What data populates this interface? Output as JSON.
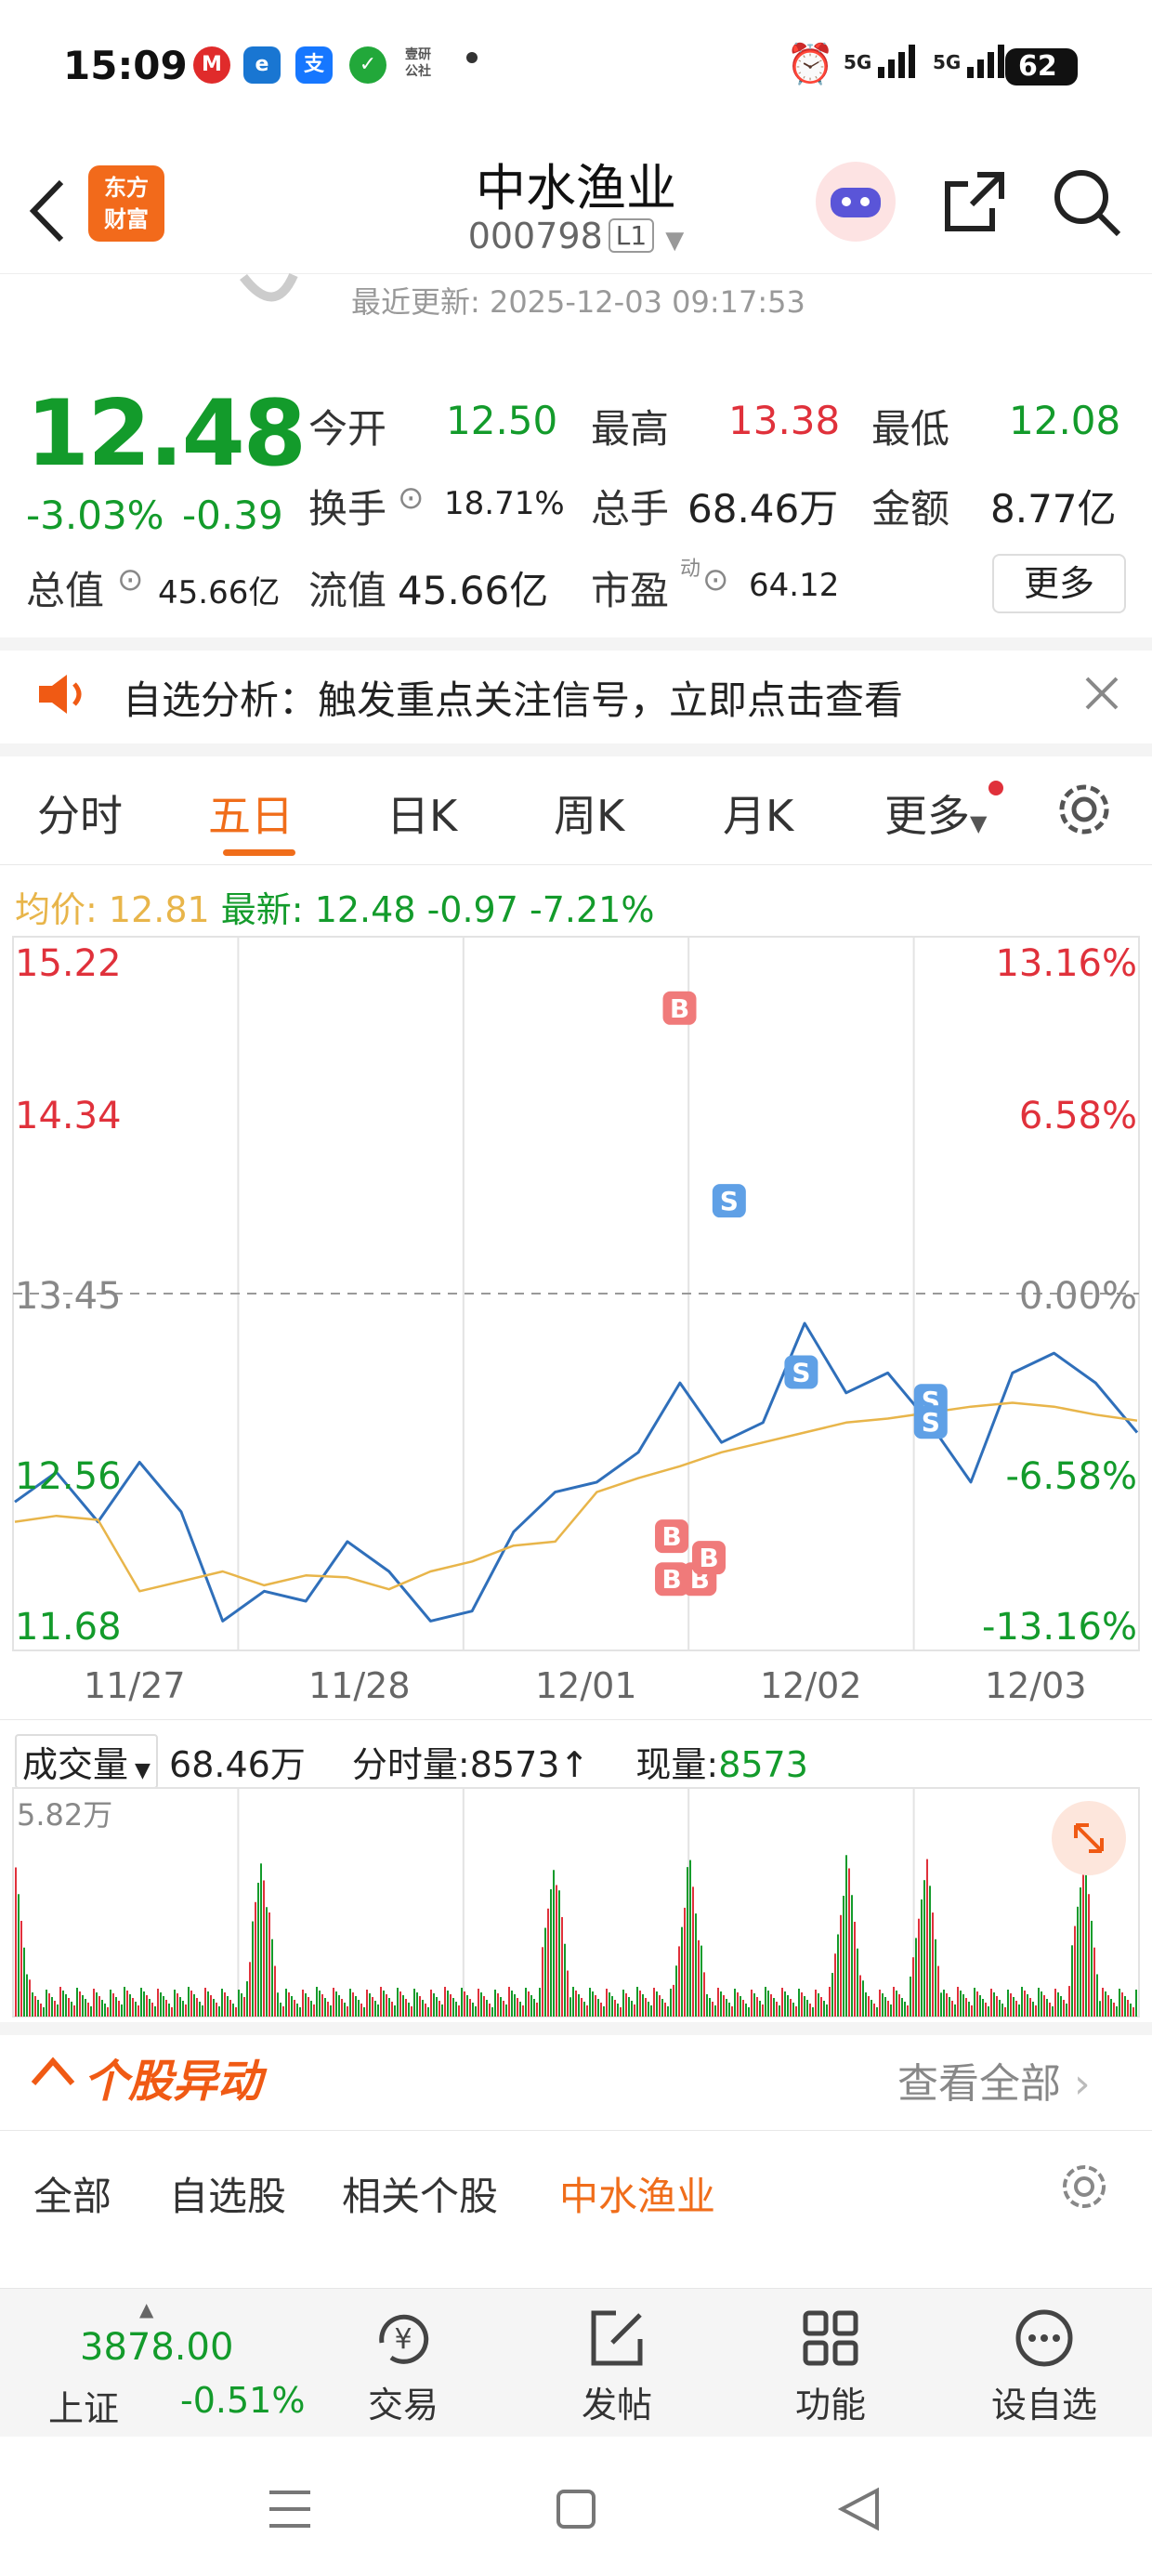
{
  "status_bar": {
    "time": "15:09",
    "battery": "62",
    "network_1": "5G",
    "network_2": "5G"
  },
  "header": {
    "brand_line1": "东方",
    "brand_line2": "财富",
    "title": "中水渔业",
    "code": "000798",
    "level": "L1",
    "update_time": "最近更新: 2025-12-03 09:17:53"
  },
  "quote": {
    "price": "12.48",
    "change_pct": "-3.03%",
    "change": "-0.39",
    "open_label": "今开",
    "open": "12.50",
    "high_label": "最高",
    "high": "13.38",
    "low_label": "最低",
    "low": "12.08",
    "turnover_label": "换手",
    "turnover": "18.71%",
    "volume_label": "总手",
    "volume": "68.46万",
    "amount_label": "金额",
    "amount": "8.77亿",
    "mktcap_label": "总值",
    "mktcap": "45.66亿",
    "float_label": "流值",
    "float_cap": "45.66亿",
    "pe_label": "市盈",
    "pe_sup": "动",
    "pe": "64.12",
    "more_label": "更多"
  },
  "notice": {
    "text": "自选分析：触发重点关注信号，立即点击查看"
  },
  "tabs": [
    "分时",
    "五日",
    "日K",
    "周K",
    "月K",
    "更多"
  ],
  "active_tab": "五日",
  "info_line": {
    "avg_label": "均价:",
    "avg": "12.81",
    "latest_label": "最新:",
    "latest": "12.48",
    "change": "-0.97",
    "change_pct": "-7.21%"
  },
  "chart_data": {
    "type": "line",
    "y_ticks": [
      "15.22",
      "14.34",
      "13.45",
      "12.56",
      "11.68"
    ],
    "y_pct_ticks": [
      "13.16%",
      "6.58%",
      "0.00%",
      "-6.58%",
      "-13.16%"
    ],
    "ylim": [
      11.68,
      15.22
    ],
    "prev_close": 13.45,
    "x": [
      "11/27",
      "11/28",
      "12/01",
      "12/02",
      "12/03"
    ],
    "series": [
      {
        "values": [
          12.4,
          12.55,
          12.3,
          12.6,
          12.35,
          11.8,
          11.95,
          11.9,
          12.2,
          12.05,
          11.8,
          11.85,
          12.25,
          12.45,
          12.5,
          12.65,
          13.0,
          12.7,
          12.8,
          13.3,
          12.95,
          13.05,
          12.8,
          12.5,
          13.05,
          13.15,
          13.0,
          12.75
        ]
      },
      {
        "values": [
          12.3,
          12.33,
          12.31,
          11.95,
          12.0,
          12.05,
          11.98,
          12.03,
          12.02,
          11.96,
          12.05,
          12.1,
          12.18,
          12.2,
          12.45,
          12.52,
          12.58,
          12.65,
          12.7,
          12.75,
          12.8,
          12.82,
          12.85,
          12.88,
          12.9,
          12.88,
          12.84,
          12.81
        ]
      }
    ],
    "trade_markers": [
      "B",
      "B",
      "B",
      "B",
      "B",
      "S",
      "S",
      "S",
      "S"
    ],
    "volume": {
      "label": "成交量",
      "total": "68.46万",
      "tick_label": "分时量:8573↑",
      "now_label": "现量:",
      "now": "8573",
      "max": "5.82万"
    }
  },
  "movers": {
    "title": "个股异动",
    "view_all": "查看全部",
    "tabs": [
      "全部",
      "自选股",
      "相关个股",
      "中水渔业"
    ],
    "active_tab": "中水渔业"
  },
  "bottom_bar": {
    "index_value": "3878.00",
    "index_name": "上证",
    "index_change": "-0.51%",
    "items": [
      "交易",
      "发帖",
      "功能",
      "设自选"
    ]
  },
  "colors": {
    "up": "#e0313b",
    "down": "#139b2b",
    "accent": "#f06d1a",
    "avg_line": "#e8b54a",
    "price_line": "#2f6fba"
  }
}
